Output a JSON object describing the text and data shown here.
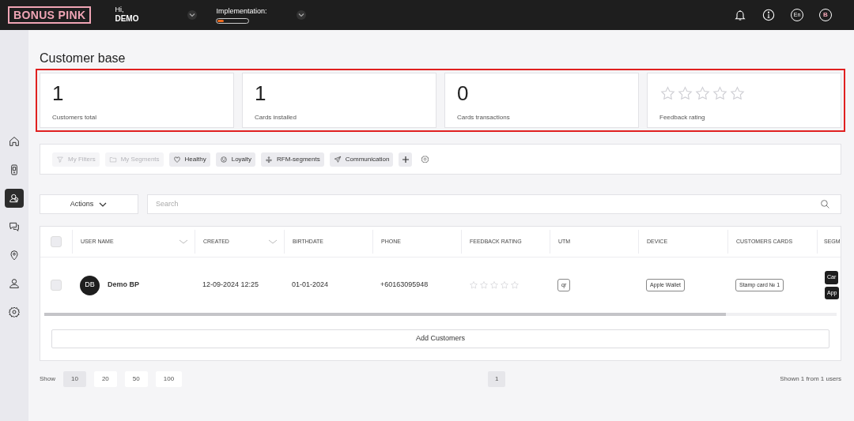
{
  "header": {
    "logo": "BONUS PINK",
    "greeting": "Hi,",
    "user": "DEMO",
    "implementation": {
      "label": "Implementation:",
      "level": 0.2
    },
    "language": "En",
    "avatar": "B"
  },
  "sidebar": {
    "items": [
      {
        "selected": false
      },
      {
        "selected": false
      },
      {
        "selected": true
      },
      {
        "selected": false
      },
      {
        "selected": false
      },
      {
        "selected": false
      },
      {
        "selected": false
      }
    ]
  },
  "page_title": "Customer base",
  "stats": {
    "highlighted": true,
    "cards": [
      {
        "kind": "number",
        "value": "1",
        "label": "Customers total"
      },
      {
        "kind": "number",
        "value": "1",
        "label": "Cards installed"
      },
      {
        "kind": "number",
        "value": "0",
        "label": "Cards transactions"
      },
      {
        "kind": "stars",
        "stars": 0,
        "label": "Feedback rating"
      }
    ]
  },
  "filters": [
    {
      "label": "My Filters",
      "disabled": true
    },
    {
      "label": "My Segments",
      "disabled": true
    },
    {
      "label": "Healthy",
      "disabled": false
    },
    {
      "label": "Loyalty",
      "disabled": false
    },
    {
      "label": "RFM-segments",
      "disabled": false
    },
    {
      "label": "Communication",
      "disabled": false
    }
  ],
  "actions": "Actions",
  "search": {
    "placeholder": "Search"
  },
  "table": {
    "select_all": {
      "checked": false
    },
    "columns": [
      {
        "label": "USER NAME",
        "sortable": true
      },
      {
        "label": "CREATED",
        "sortable": true
      },
      {
        "label": "BIRTHDATE",
        "sortable": false
      },
      {
        "label": "PHONE",
        "sortable": false
      },
      {
        "label": "FEEDBACK RATING",
        "sortable": false
      },
      {
        "label": "UTM",
        "sortable": false
      },
      {
        "label": "DEVICE",
        "sortable": false
      },
      {
        "label": "CUSTOMERS CARDS",
        "sortable": false
      },
      {
        "label": "SEGM"
      }
    ],
    "rows": [
      {
        "checked": false,
        "initials": "DB",
        "name": "Demo BP",
        "created": "12-09-2024 12:25",
        "birthdate": "01-01-2024",
        "phone": "+60163095948",
        "stars": 0,
        "utm": "qr",
        "device": "Apple Wallet",
        "card": "Stamp card № 1",
        "segments": [
          "Car",
          "App"
        ]
      }
    ]
  },
  "add_button": "Add Customers",
  "footer": {
    "show_label": "Show",
    "page_sizes": [
      {
        "label": "10",
        "selected": true
      },
      {
        "label": "20",
        "selected": false
      },
      {
        "label": "50",
        "selected": false
      },
      {
        "label": "100",
        "selected": false
      }
    ],
    "pages": [
      {
        "label": "1",
        "selected": true
      }
    ],
    "summary": "Shown 1 from 1 users"
  }
}
